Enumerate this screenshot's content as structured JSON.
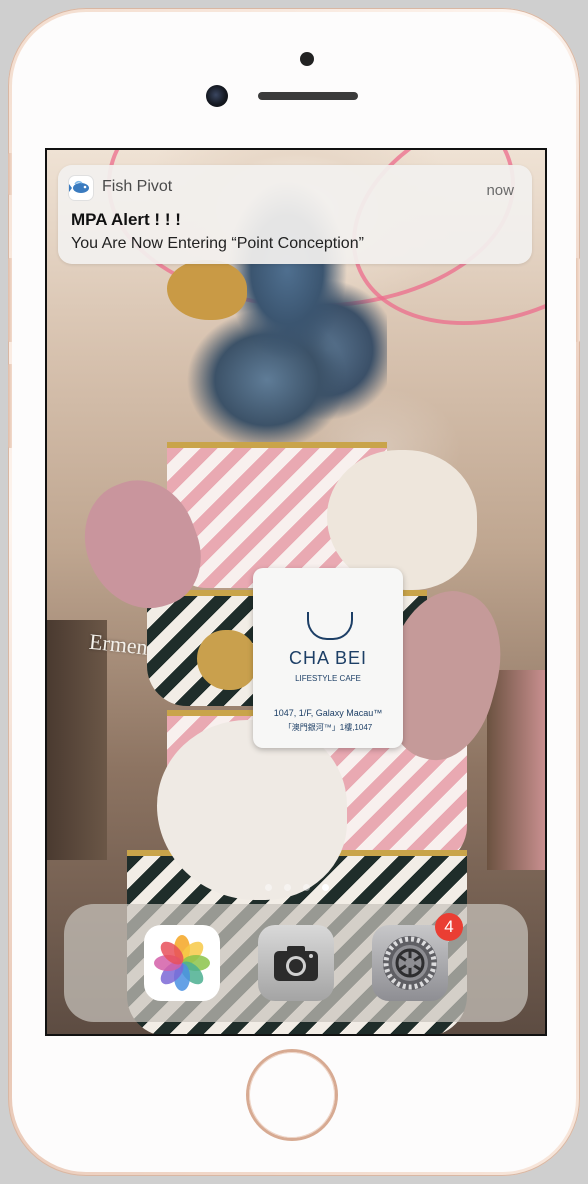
{
  "notification": {
    "app_name": "Fish Pivot",
    "time": "now",
    "title": "MPA Alert ! ! !",
    "body": "You Are Now Entering “Point Conception”",
    "icon": "fish-icon"
  },
  "wallpaper": {
    "store_sign": "Ermenegild",
    "tag": {
      "brand": "CHA BEI",
      "tagline": "LIFESTYLE CAFE",
      "address": "1047, 1/F, Galaxy Macau™",
      "address_local": "「澳門銀河™」1樓,1047"
    }
  },
  "page_indicator": {
    "pages": 4,
    "current": 4
  },
  "dock": {
    "apps": [
      {
        "name": "Photos",
        "icon": "photos-icon"
      },
      {
        "name": "Camera",
        "icon": "camera-icon"
      },
      {
        "name": "Settings",
        "icon": "settings-gear-icon",
        "badge": "4"
      }
    ]
  },
  "colors": {
    "badge": "#ea3e33",
    "phone_trim": "#d7aa92"
  }
}
